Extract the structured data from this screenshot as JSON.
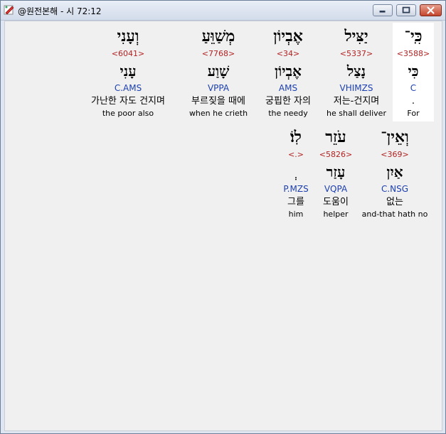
{
  "window": {
    "title": "@원전본해 - 시 72:12",
    "controls": {
      "minimize": "minimize-button",
      "maximize": "maximize-button",
      "close": "close-button"
    }
  },
  "rows": [
    {
      "words": [
        {
          "hebrew": "כִּֽי־",
          "strong": "<3588>",
          "lemma": "כִּי",
          "morph": "C",
          "korean": ".",
          "english": "For",
          "selected": true
        },
        {
          "hebrew": "יַצִּיל",
          "strong": "<5337>",
          "lemma": "נָצַל",
          "morph": "VHIMZS",
          "korean": "저는-건지며",
          "english": "he shall deliver"
        },
        {
          "hebrew": "אֶבְיוֹן",
          "strong": "<34>",
          "lemma": "אֶבְיוֹן",
          "morph": "AMS",
          "korean": "궁핍한 자의",
          "english": "the needy"
        },
        {
          "hebrew": "מְשַׁוֵּעַ",
          "strong": "<7768>",
          "lemma": "שָׁוַע",
          "morph": "VPPA",
          "korean": "부르짖을 때에",
          "english": "when he crieth"
        },
        {
          "hebrew": "וְעָנִי",
          "strong": "<6041>",
          "lemma": "עָנִי",
          "morph": "C.AMS",
          "korean": "가난한 자도 건지며",
          "english": "the poor also"
        }
      ]
    },
    {
      "words": [
        {
          "hebrew": "וְאֵין־",
          "strong": "<369>",
          "lemma": "אַיִן",
          "morph": "C.NSG",
          "korean": "없는",
          "english": "and-that hath no"
        },
        {
          "hebrew": "עֹזֵר",
          "strong": "<5826>",
          "lemma": "עָזַר",
          "morph": "VQPA",
          "korean": "도움이",
          "english": "helper"
        },
        {
          "hebrew": "לֽוֹ׃",
          "strong": "<.>",
          "lemma": "ְ",
          "morph": "P.MZS",
          "korean": "그를",
          "english": "him"
        }
      ]
    }
  ],
  "colors": {
    "strong": "#b22222",
    "morph": "#1c3fb0",
    "selected_bg": "#ffffff"
  }
}
